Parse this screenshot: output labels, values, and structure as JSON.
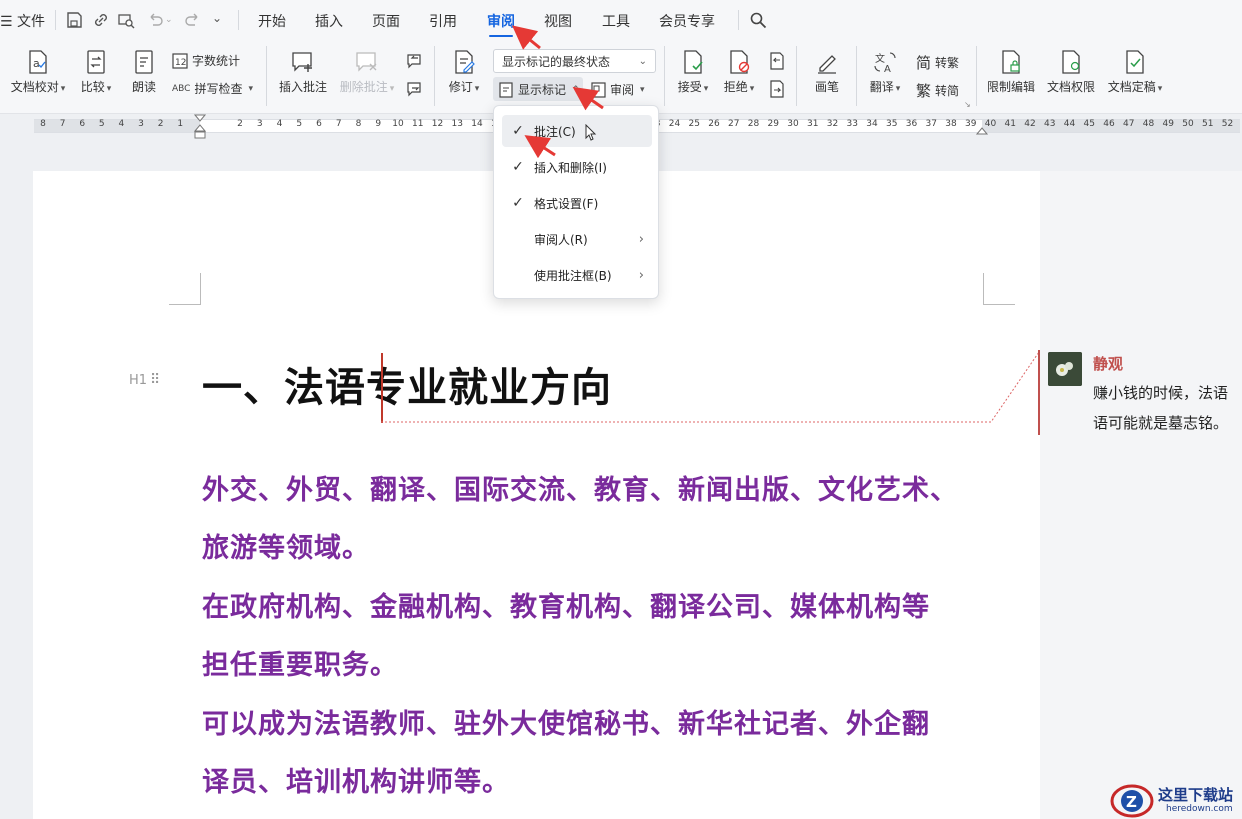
{
  "menubar": {
    "file_label": "文件",
    "tabs": [
      {
        "label": "开始"
      },
      {
        "label": "插入"
      },
      {
        "label": "页面"
      },
      {
        "label": "引用"
      },
      {
        "label": "审阅"
      },
      {
        "label": "视图"
      },
      {
        "label": "工具"
      },
      {
        "label": "会员专享"
      }
    ],
    "active_tab": "审阅"
  },
  "ribbon": {
    "doc_check": "文档校对",
    "compare": "比较",
    "read_aloud": "朗读",
    "word_count": "字数统计",
    "spell_check": "拼写检查",
    "insert_comment": "插入批注",
    "delete_comment": "删除批注",
    "revise": "修订",
    "display_state": "显示标记的最终状态",
    "show_markup": "显示标记",
    "review": "审阅",
    "accept": "接受",
    "reject": "拒绝",
    "pen": "画笔",
    "translate": "翻译",
    "to_traditional": "转繁",
    "to_simplified": "转简",
    "trad_glyph": "简",
    "simp_glyph": "繁",
    "restrict_edit": "限制编辑",
    "doc_permission": "文档权限",
    "doc_finalize": "文档定稿"
  },
  "ruler": {
    "left_numbers": [
      "8",
      "7",
      "6",
      "5",
      "4",
      "3",
      "2",
      "1"
    ],
    "right_numbers": [
      "2",
      "3",
      "4",
      "5",
      "6",
      "7",
      "8",
      "9",
      "10",
      "11",
      "12",
      "13",
      "14",
      "15",
      "16",
      "17",
      "18",
      "19",
      "20",
      "21",
      "22",
      "23",
      "24",
      "25",
      "26",
      "27",
      "28",
      "29",
      "30",
      "31",
      "32",
      "33",
      "34",
      "35",
      "36",
      "37",
      "38",
      "39",
      "40",
      "41",
      "42",
      "43",
      "44",
      "45",
      "46",
      "47",
      "48",
      "49",
      "50",
      "51",
      "52"
    ]
  },
  "dropdown_menu": {
    "items": [
      {
        "label": "批注(C)",
        "checked": true
      },
      {
        "label": "插入和删除(I)",
        "checked": true
      },
      {
        "label": "格式设置(F)",
        "checked": true
      },
      {
        "label": "审阅人(R)",
        "checked": false,
        "submenu": true
      },
      {
        "label": "使用批注框(B)",
        "checked": false,
        "submenu": true
      }
    ]
  },
  "document": {
    "heading_marker": "H1",
    "heading": "一、法语专业就业方向",
    "paragraph_lines": [
      "外交、外贸、翻译、国际交流、教育、新闻出版、文化艺术、",
      "旅游等领域。",
      "在政府机构、金融机构、教育机构、翻译公司、媒体机构等",
      "担任重要职务。",
      "可以成为法语教师、驻外大使馆秘书、新华社记者、外企翻",
      "译员、培训机构讲师等。"
    ]
  },
  "comment": {
    "author": "静观",
    "text_line1": "赚小钱的时候，法语",
    "text_line2": "语可能就是墓志铭。"
  },
  "watermark": {
    "title": "这里下载站",
    "url": "heredown.com"
  },
  "colors": {
    "accent": "#1565e0",
    "paragraph": "#7a2b9c",
    "comment_author": "#c0504d",
    "arrow": "#e53935"
  }
}
